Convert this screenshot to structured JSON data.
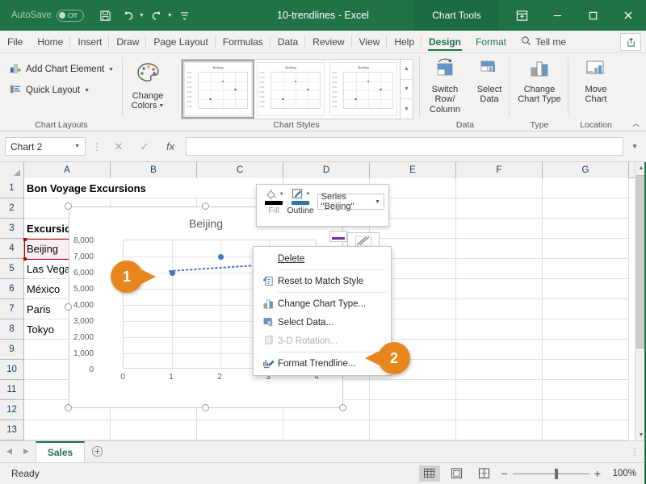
{
  "titlebar": {
    "autosave_label": "AutoSave",
    "autosave_state": "Off",
    "document_title": "10-trendlines  -  Excel",
    "context_tab_group": "Chart Tools",
    "qat": [
      {
        "name": "save-icon",
        "label": "Save"
      },
      {
        "name": "undo-icon",
        "label": "Undo"
      },
      {
        "name": "redo-icon",
        "label": "Redo"
      },
      {
        "name": "customize-qat-icon",
        "label": "Customize Quick Access Toolbar"
      }
    ],
    "window_buttons": [
      {
        "name": "ribbon-display-options-icon",
        "label": "Ribbon Display Options"
      },
      {
        "name": "minimize-icon",
        "label": "Minimize"
      },
      {
        "name": "maximize-icon",
        "label": "Maximize"
      },
      {
        "name": "close-icon",
        "label": "Close"
      }
    ]
  },
  "ribbon_tabs": [
    {
      "label": "File",
      "active": false
    },
    {
      "label": "Home",
      "active": false
    },
    {
      "label": "Insert",
      "active": false
    },
    {
      "label": "Draw",
      "active": false
    },
    {
      "label": "Page Layout",
      "active": false
    },
    {
      "label": "Formulas",
      "active": false
    },
    {
      "label": "Data",
      "active": false
    },
    {
      "label": "Review",
      "active": false
    },
    {
      "label": "View",
      "active": false
    },
    {
      "label": "Help",
      "active": false
    },
    {
      "label": "Design",
      "active": true
    },
    {
      "label": "Format",
      "active": false
    }
  ],
  "tell_me": "Tell me",
  "share_button": "Share",
  "ribbon": {
    "groups": [
      {
        "label": "Chart Layouts"
      },
      {
        "label": "Chart Styles"
      },
      {
        "label": "Data"
      },
      {
        "label": "Type"
      },
      {
        "label": "Location"
      }
    ],
    "chart_layouts": [
      {
        "label": "Add Chart Element",
        "icon": "add-chart-element-icon",
        "has_caret": true
      },
      {
        "label": "Quick Layout",
        "icon": "quick-layout-icon",
        "has_caret": true
      }
    ],
    "change_colors": {
      "line1": "Change",
      "line2": "Colors",
      "icon": "palette-icon"
    },
    "chart_styles": [
      {
        "title": "Beijing",
        "selected": true
      },
      {
        "title": "Beijing",
        "selected": false
      },
      {
        "title": "Beijing",
        "selected": false
      }
    ],
    "data_group": [
      {
        "line1": "Switch Row/",
        "line2": "Column",
        "icon": "switch-row-column-icon"
      },
      {
        "line1": "Select",
        "line2": "Data",
        "icon": "select-data-icon"
      }
    ],
    "type_group": [
      {
        "line1": "Change",
        "line2": "Chart Type",
        "icon": "change-chart-type-icon"
      }
    ],
    "location_group": [
      {
        "line1": "Move",
        "line2": "Chart",
        "icon": "move-chart-icon"
      }
    ],
    "collapse_label": "Collapse the Ribbon"
  },
  "formula_bar": {
    "name_box_value": "Chart 2",
    "cancel_label": "Cancel",
    "enter_label": "Enter",
    "function_label": "Insert Function",
    "formula_value": ""
  },
  "grid": {
    "columns": [
      "A",
      "B",
      "C",
      "D",
      "E",
      "F",
      "G"
    ],
    "rows": [
      "1",
      "2",
      "3",
      "4",
      "5",
      "6",
      "7",
      "8",
      "9",
      "10",
      "11",
      "12",
      "13"
    ],
    "cells": {
      "A1": "Bon Voyage Excursions",
      "A3": "Excursion",
      "A4": "Beijing",
      "A5": "Las Vegas",
      "A6": "México",
      "A7": "Paris",
      "A8": "Tokyo"
    },
    "source_highlight_cell": "A4"
  },
  "chart": {
    "title": "Beijing",
    "selected": true
  },
  "chart_data": {
    "type": "scatter",
    "title": "Beijing",
    "xlabel": "",
    "ylabel": "",
    "xlim": [
      0,
      4
    ],
    "ylim": [
      0,
      8000
    ],
    "x_ticks": [
      "0",
      "1",
      "2",
      "3",
      "4"
    ],
    "y_ticks": [
      "0",
      "1,000",
      "2,000",
      "3,000",
      "4,000",
      "5,000",
      "6,000",
      "7,000",
      "8,000"
    ],
    "grid": true,
    "legend": "none",
    "series": [
      {
        "name": "Beijing",
        "color": "#4472c4",
        "points": [
          {
            "x": 1,
            "y": 6000
          },
          {
            "x": 2,
            "y": 7000
          }
        ]
      }
    ],
    "trendline": {
      "style": "dotted",
      "color": "#4472c4",
      "from": {
        "x": 1,
        "y": 6100
      },
      "to": {
        "x": 3.2,
        "y": 6600
      }
    }
  },
  "mini_toolbar": {
    "fill_label": "Fill",
    "fill_color": "#000000",
    "outline_label": "Outline",
    "outline_color": "#2e75b6",
    "series_selector": "Series \"Beijing\""
  },
  "context_menu": {
    "items": [
      {
        "label": "Delete",
        "icon": null,
        "disabled": false,
        "accel": "D"
      },
      {
        "label": "Reset to Match Style",
        "icon": "reset-style-icon",
        "disabled": false,
        "accel": "a"
      },
      {
        "label": "Change Chart Type...",
        "icon": "change-chart-type-icon",
        "disabled": false,
        "accel": "y"
      },
      {
        "label": "Select Data...",
        "icon": "select-data-icon",
        "disabled": false,
        "accel": "e"
      },
      {
        "label": "3-D Rotation...",
        "icon": "rotation-icon",
        "disabled": true,
        "accel": "R"
      },
      {
        "label": "Format Trendline...",
        "icon": "format-trendline-icon",
        "disabled": false,
        "accel": "F"
      }
    ]
  },
  "callouts": [
    {
      "number": "1",
      "target": "trendline-data-point"
    },
    {
      "number": "2",
      "target": "format-trendline-menu-item"
    }
  ],
  "sheet_tabs": {
    "tabs": [
      {
        "label": "Sales",
        "active": true
      }
    ],
    "add_sheet_label": "New sheet",
    "prev_label": "Previous Sheet",
    "next_label": "Next Sheet"
  },
  "status_bar": {
    "status_text": "Ready",
    "views": [
      {
        "name": "normal-view-icon",
        "label": "Normal",
        "active": true
      },
      {
        "name": "page-layout-view-icon",
        "label": "Page Layout",
        "active": false
      },
      {
        "name": "page-break-view-icon",
        "label": "Page Break Preview",
        "active": false
      }
    ],
    "zoom_out_label": "Zoom Out",
    "zoom_in_label": "Zoom In",
    "zoom_value": "100%"
  },
  "theme": {
    "accent_green": "#217346",
    "callout_orange": "#e8861e",
    "series_blue": "#4472c4"
  }
}
